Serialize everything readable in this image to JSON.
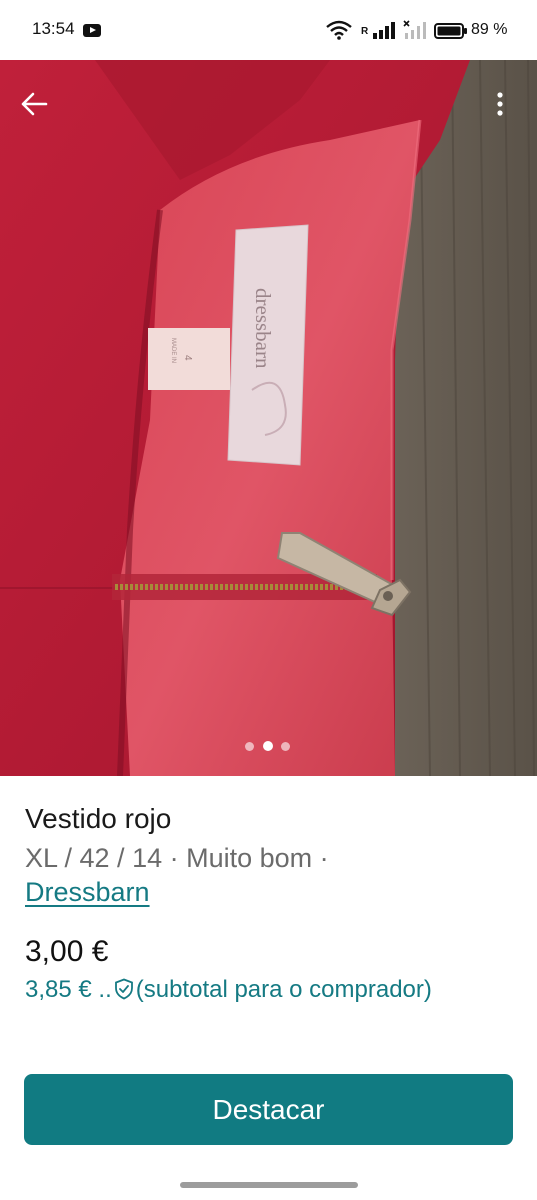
{
  "status_bar": {
    "time": "13:54",
    "battery": "89 %",
    "network_letter": "R"
  },
  "photo": {
    "description_icon": "product-photo",
    "label_text": "dressbarn",
    "size_tag": "4",
    "made_in": "MADE IN",
    "carousel": {
      "count": 3,
      "active_index": 1
    }
  },
  "item": {
    "title": "Vestido rojo",
    "meta": "XL / 42 / 14 · Muito bom ·",
    "brand": "Dressbarn"
  },
  "pricing": {
    "price": "3,00 €",
    "buyer_price": "3,85 € ..",
    "buyer_note": "(subtotal para o comprador)"
  },
  "actions": {
    "primary_label": "Destacar"
  },
  "colors": {
    "accent": "#117b82",
    "link": "#157a83"
  },
  "icons": [
    "back-arrow-icon",
    "more-vert-icon",
    "shield-check-icon",
    "youtube-icon",
    "wifi-icon",
    "signal-icon",
    "battery-icon"
  ]
}
